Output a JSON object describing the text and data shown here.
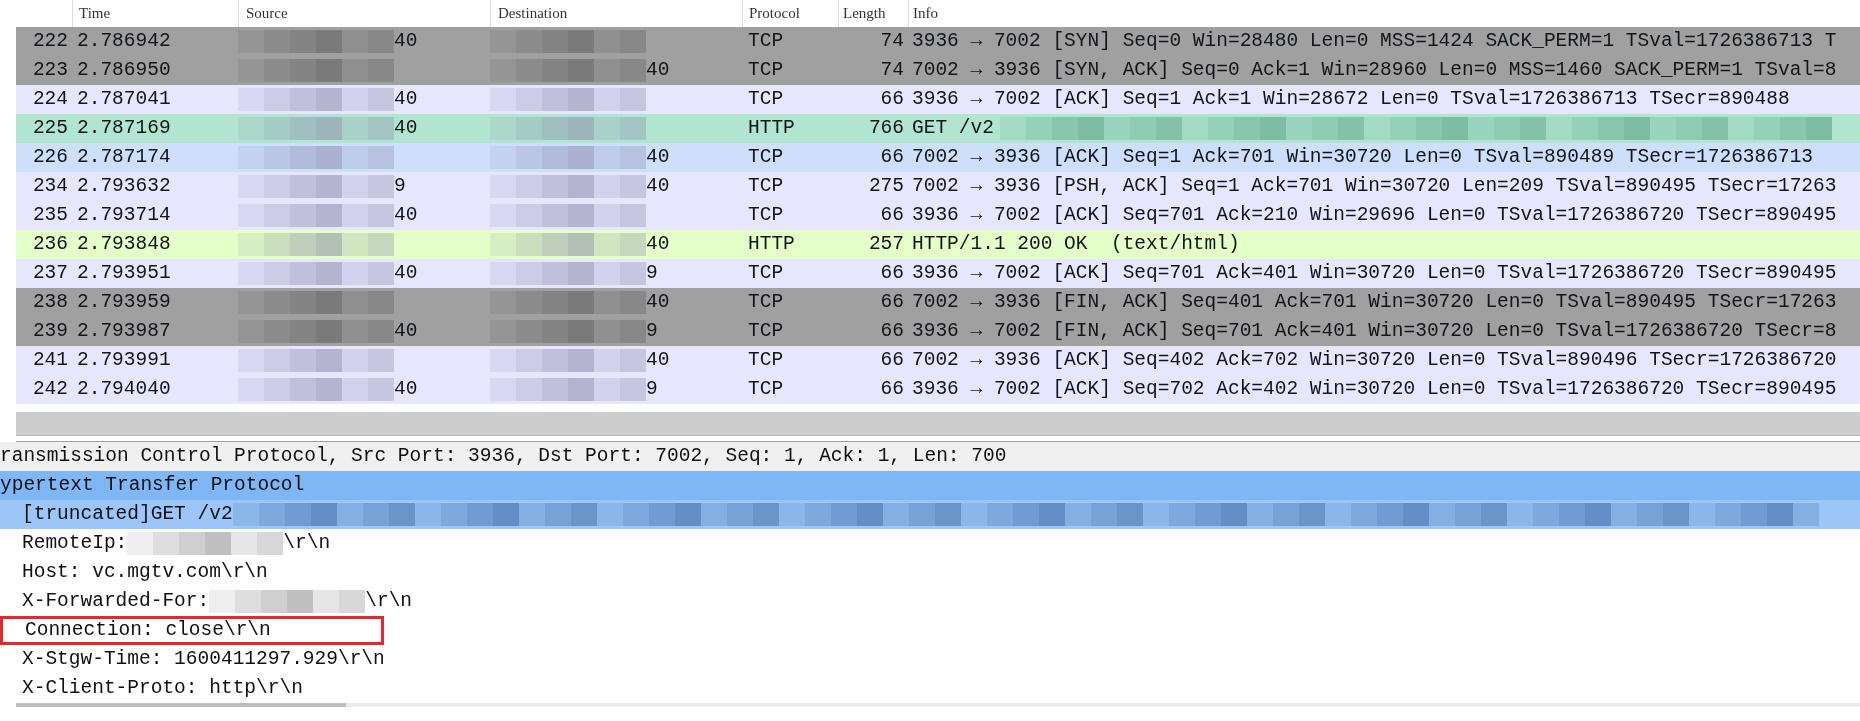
{
  "packet_list": {
    "columns": [
      "Time",
      "Source",
      "Destination",
      "Protocol",
      "Length",
      "Info"
    ],
    "rows": [
      {
        "no": "222",
        "time": "2.786942",
        "source": "40",
        "destination": "",
        "protocol": "TCP",
        "length": "74",
        "info": "3936 → 7002 [SYN] Seq=0 Win=28480 Len=0 MSS=1424 SACK_PERM=1 TSval=1726386713 T",
        "info_redacted": false,
        "color": "#a0a0a0"
      },
      {
        "no": "223",
        "time": "2.786950",
        "source": "",
        "destination": "40",
        "protocol": "TCP",
        "length": "74",
        "info": "7002 → 3936 [SYN, ACK] Seq=0 Ack=1 Win=28960 Len=0 MSS=1460 SACK_PERM=1 TSval=8",
        "info_redacted": false,
        "color": "#a0a0a0"
      },
      {
        "no": "224",
        "time": "2.787041",
        "source": "40",
        "destination": "",
        "protocol": "TCP",
        "length": "66",
        "info": "3936 → 7002 [ACK] Seq=1 Ack=1 Win=28672 Len=0 TSval=1726386713 TSecr=890488",
        "info_redacted": false,
        "color": "#e7e6ff"
      },
      {
        "no": "225",
        "time": "2.787169",
        "source": "40",
        "destination": "",
        "protocol": "HTTP",
        "length": "766",
        "info": "GET /v2",
        "info_redacted": true,
        "color": "#b1e5d0"
      },
      {
        "no": "226",
        "time": "2.787174",
        "source": "",
        "destination": "40",
        "protocol": "TCP",
        "length": "66",
        "info": "7002 → 3936 [ACK] Seq=1 Ack=701 Win=30720 Len=0 TSval=890489 TSecr=1726386713",
        "info_redacted": false,
        "color": "#cddffb"
      },
      {
        "no": "234",
        "time": "2.793632",
        "source": "9",
        "destination": "40",
        "protocol": "TCP",
        "length": "275",
        "info": "7002 → 3936 [PSH, ACK] Seq=1 Ack=701 Win=30720 Len=209 TSval=890495 TSecr=17263",
        "info_redacted": false,
        "color": "#e7e6ff"
      },
      {
        "no": "235",
        "time": "2.793714",
        "source": "40",
        "destination": "",
        "protocol": "TCP",
        "length": "66",
        "info": "3936 → 7002 [ACK] Seq=701 Ack=210 Win=29696 Len=0 TSval=1726386720 TSecr=890495",
        "info_redacted": false,
        "color": "#e7e6ff"
      },
      {
        "no": "236",
        "time": "2.793848",
        "source": "",
        "destination": "40",
        "protocol": "HTTP",
        "length": "257",
        "info": "HTTP/1.1 200 OK  (text/html)",
        "info_redacted": false,
        "color": "#e4ffc7"
      },
      {
        "no": "237",
        "time": "2.793951",
        "source": "40",
        "destination": "9",
        "protocol": "TCP",
        "length": "66",
        "info": "3936 → 7002 [ACK] Seq=701 Ack=401 Win=30720 Len=0 TSval=1726386720 TSecr=890495",
        "info_redacted": false,
        "color": "#e7e6ff"
      },
      {
        "no": "238",
        "time": "2.793959",
        "source": "",
        "destination": "40",
        "protocol": "TCP",
        "length": "66",
        "info": "7002 → 3936 [FIN, ACK] Seq=401 Ack=701 Win=30720 Len=0 TSval=890495 TSecr=17263",
        "info_redacted": false,
        "color": "#a0a0a0"
      },
      {
        "no": "239",
        "time": "2.793987",
        "source": "40",
        "destination": "9",
        "protocol": "TCP",
        "length": "66",
        "info": "3936 → 7002 [FIN, ACK] Seq=701 Ack=401 Win=30720 Len=0 TSval=1726386720 TSecr=8",
        "info_redacted": false,
        "color": "#a0a0a0"
      },
      {
        "no": "241",
        "time": "2.793991",
        "source": "",
        "destination": "40",
        "protocol": "TCP",
        "length": "66",
        "info": "7002 → 3936 [ACK] Seq=402 Ack=702 Win=30720 Len=0 TSval=890496 TSecr=1726386720",
        "info_redacted": false,
        "color": "#e7e6ff"
      },
      {
        "no": "242",
        "time": "2.794040",
        "source": "40",
        "destination": "9",
        "protocol": "TCP",
        "length": "66",
        "info": "3936 → 7002 [ACK] Seq=702 Ack=402 Win=30720 Len=0 TSval=1726386720 TSecr=890495",
        "info_redacted": false,
        "color": "#e7e6ff"
      }
    ]
  },
  "packet_details": [
    {
      "text": "ransmission Control Protocol, Src Port: 3936, Dst Port: 7002, Seq: 1, Ack: 1, Len: 700",
      "selected": false,
      "redacted": false,
      "boxed": false
    },
    {
      "text": "ypertext Transfer Protocol",
      "selected": true,
      "redacted": false,
      "boxed": false,
      "children": [
        {
          "text": "[truncated]GET /v2",
          "selected": true,
          "redacted": true,
          "boxed": false
        },
        {
          "text": "RemoteIp:",
          "text_after": "\\r\\n",
          "selected": false,
          "redacted": true,
          "boxed": false
        },
        {
          "text": "Host: vc.mgtv.com\\r\\n",
          "selected": false,
          "redacted": false,
          "boxed": false
        },
        {
          "text": "X-Forwarded-For:",
          "text_after": "\\r\\n",
          "selected": false,
          "redacted": true,
          "boxed": false
        },
        {
          "text": "Connection: close\\r\\n",
          "selected": false,
          "redacted": false,
          "boxed": true
        },
        {
          "text": "X-Stgw-Time: 1600411297.929\\r\\n",
          "selected": false,
          "redacted": false,
          "boxed": false
        },
        {
          "text": "X-Client-Proto: http\\r\\n",
          "selected": false,
          "redacted": false,
          "boxed": false
        }
      ]
    }
  ]
}
